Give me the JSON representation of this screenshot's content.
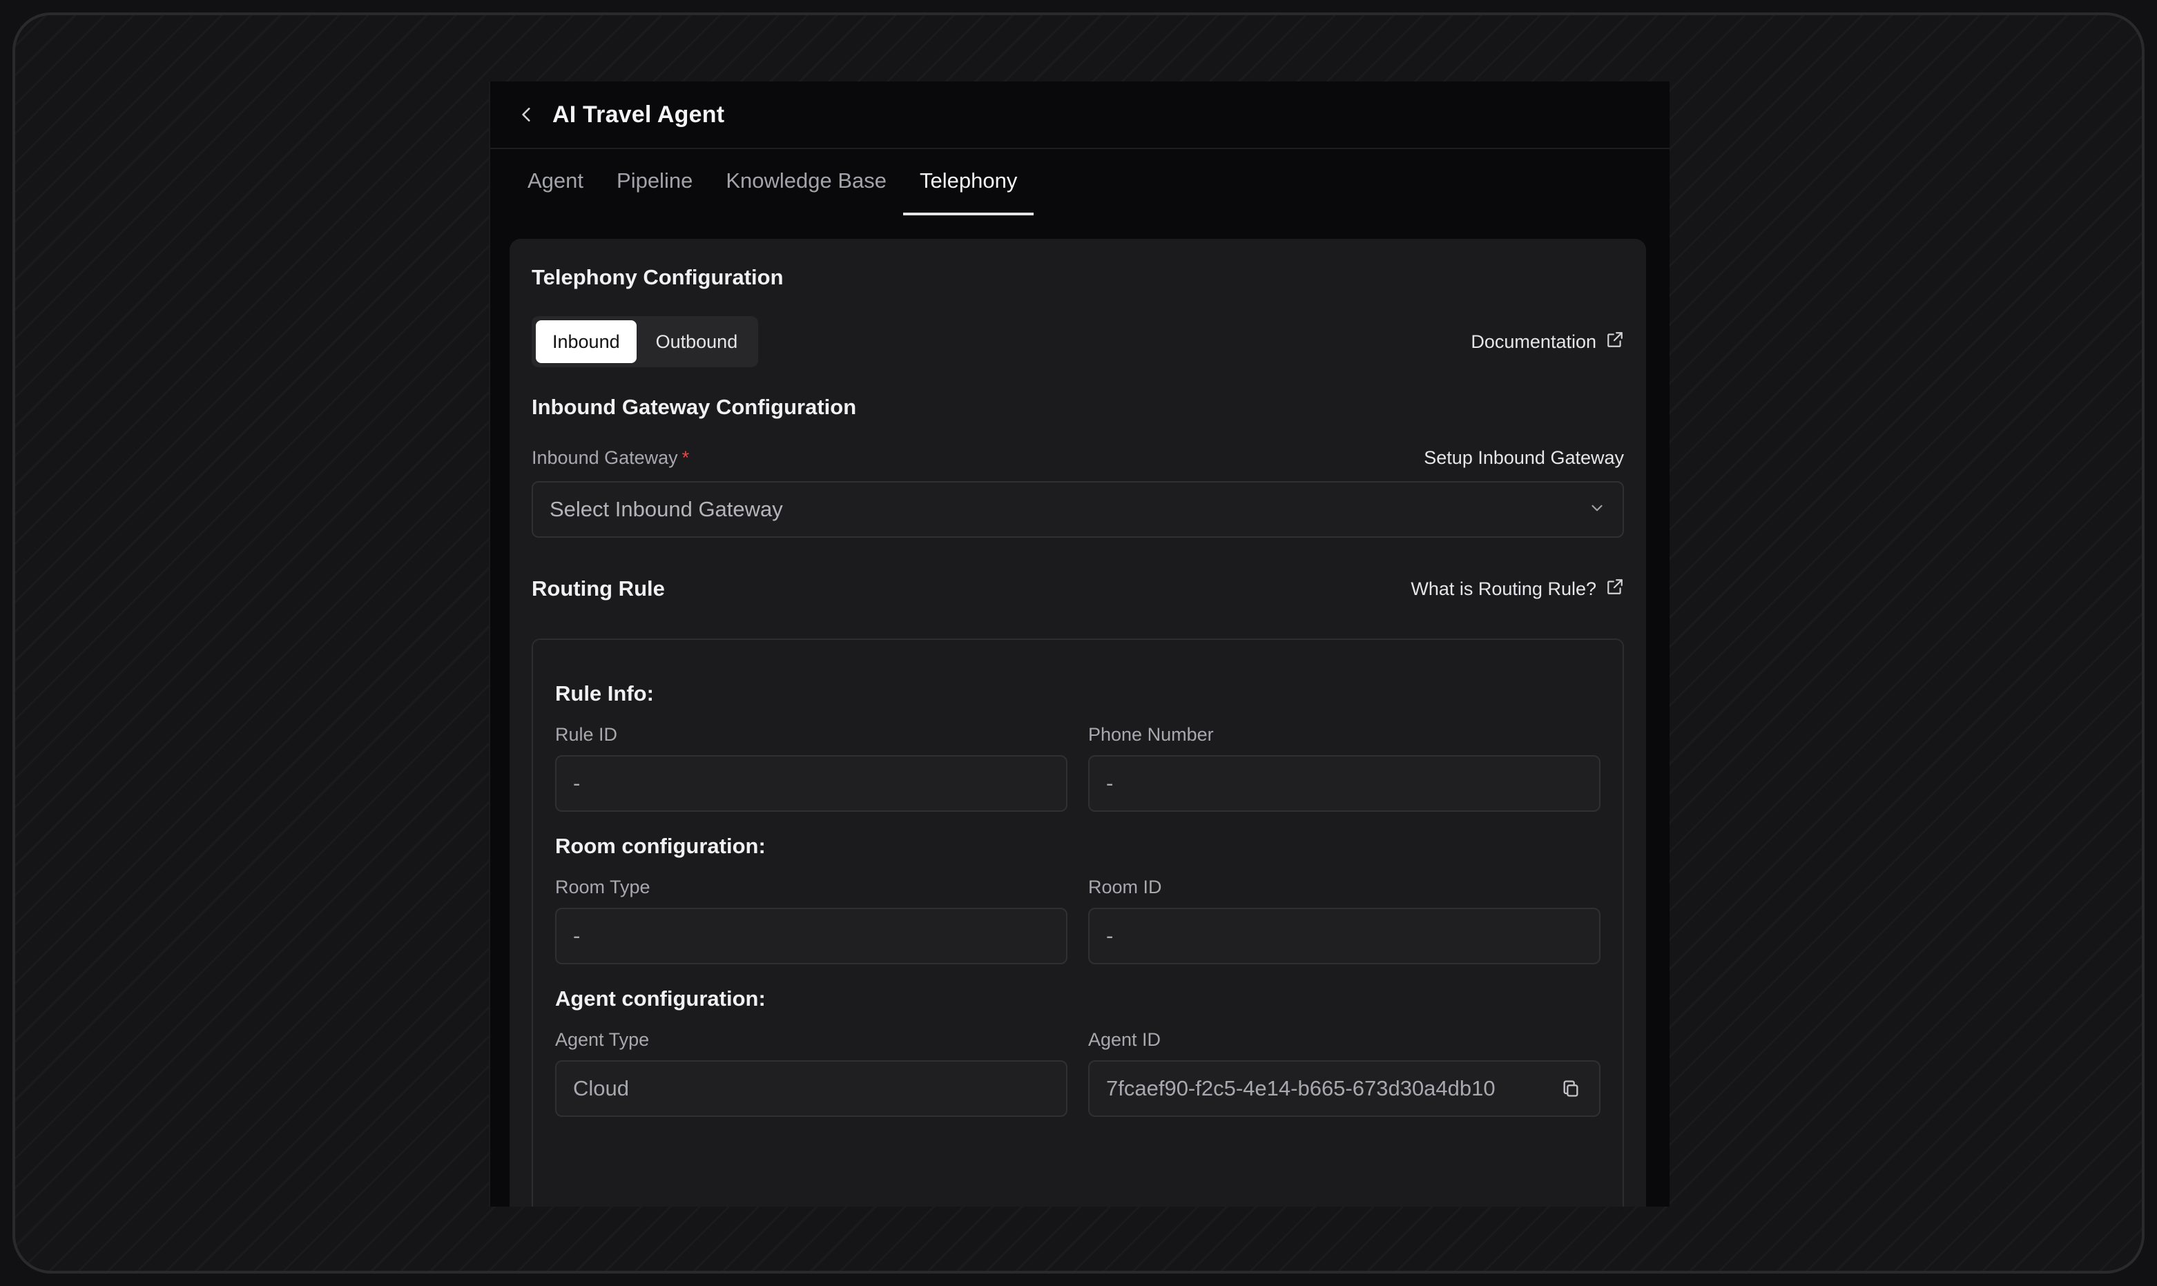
{
  "header": {
    "title": "AI Travel Agent"
  },
  "tabs": [
    {
      "label": "Agent",
      "active": false
    },
    {
      "label": "Pipeline",
      "active": false
    },
    {
      "label": "Knowledge Base",
      "active": false
    },
    {
      "label": "Telephony",
      "active": true
    }
  ],
  "telephony": {
    "heading": "Telephony Configuration",
    "segments": [
      {
        "label": "Inbound",
        "active": true
      },
      {
        "label": "Outbound",
        "active": false
      }
    ],
    "documentation_link": "Documentation",
    "gateway_heading": "Inbound Gateway Configuration",
    "gateway_label": "Inbound Gateway",
    "required_mark": "*",
    "setup_link": "Setup Inbound Gateway",
    "gateway_placeholder": "Select Inbound Gateway",
    "routing_heading": "Routing Rule",
    "routing_help_link": "What is Routing Rule?"
  },
  "rule_info": {
    "heading": "Rule Info:",
    "rule_id_label": "Rule ID",
    "rule_id_value": "-",
    "phone_label": "Phone Number",
    "phone_value": "-"
  },
  "room_config": {
    "heading": "Room configuration:",
    "room_type_label": "Room Type",
    "room_type_value": "-",
    "room_id_label": "Room ID",
    "room_id_value": "-"
  },
  "agent_config": {
    "heading": "Agent configuration:",
    "agent_type_label": "Agent Type",
    "agent_type_value": "Cloud",
    "agent_id_label": "Agent ID",
    "agent_id_value": "7fcaef90-f2c5-4e14-b665-673d30a4db10"
  },
  "icons": {
    "back": "chevron-left-icon",
    "external_link": "external-link-icon",
    "dropdown": "chevron-down-icon",
    "copy": "copy-icon"
  },
  "colors": {
    "panel_bg": "#09090b",
    "card_bg": "#1b1b1e",
    "required": "#ef4444",
    "active_segment": "#ffffff"
  }
}
